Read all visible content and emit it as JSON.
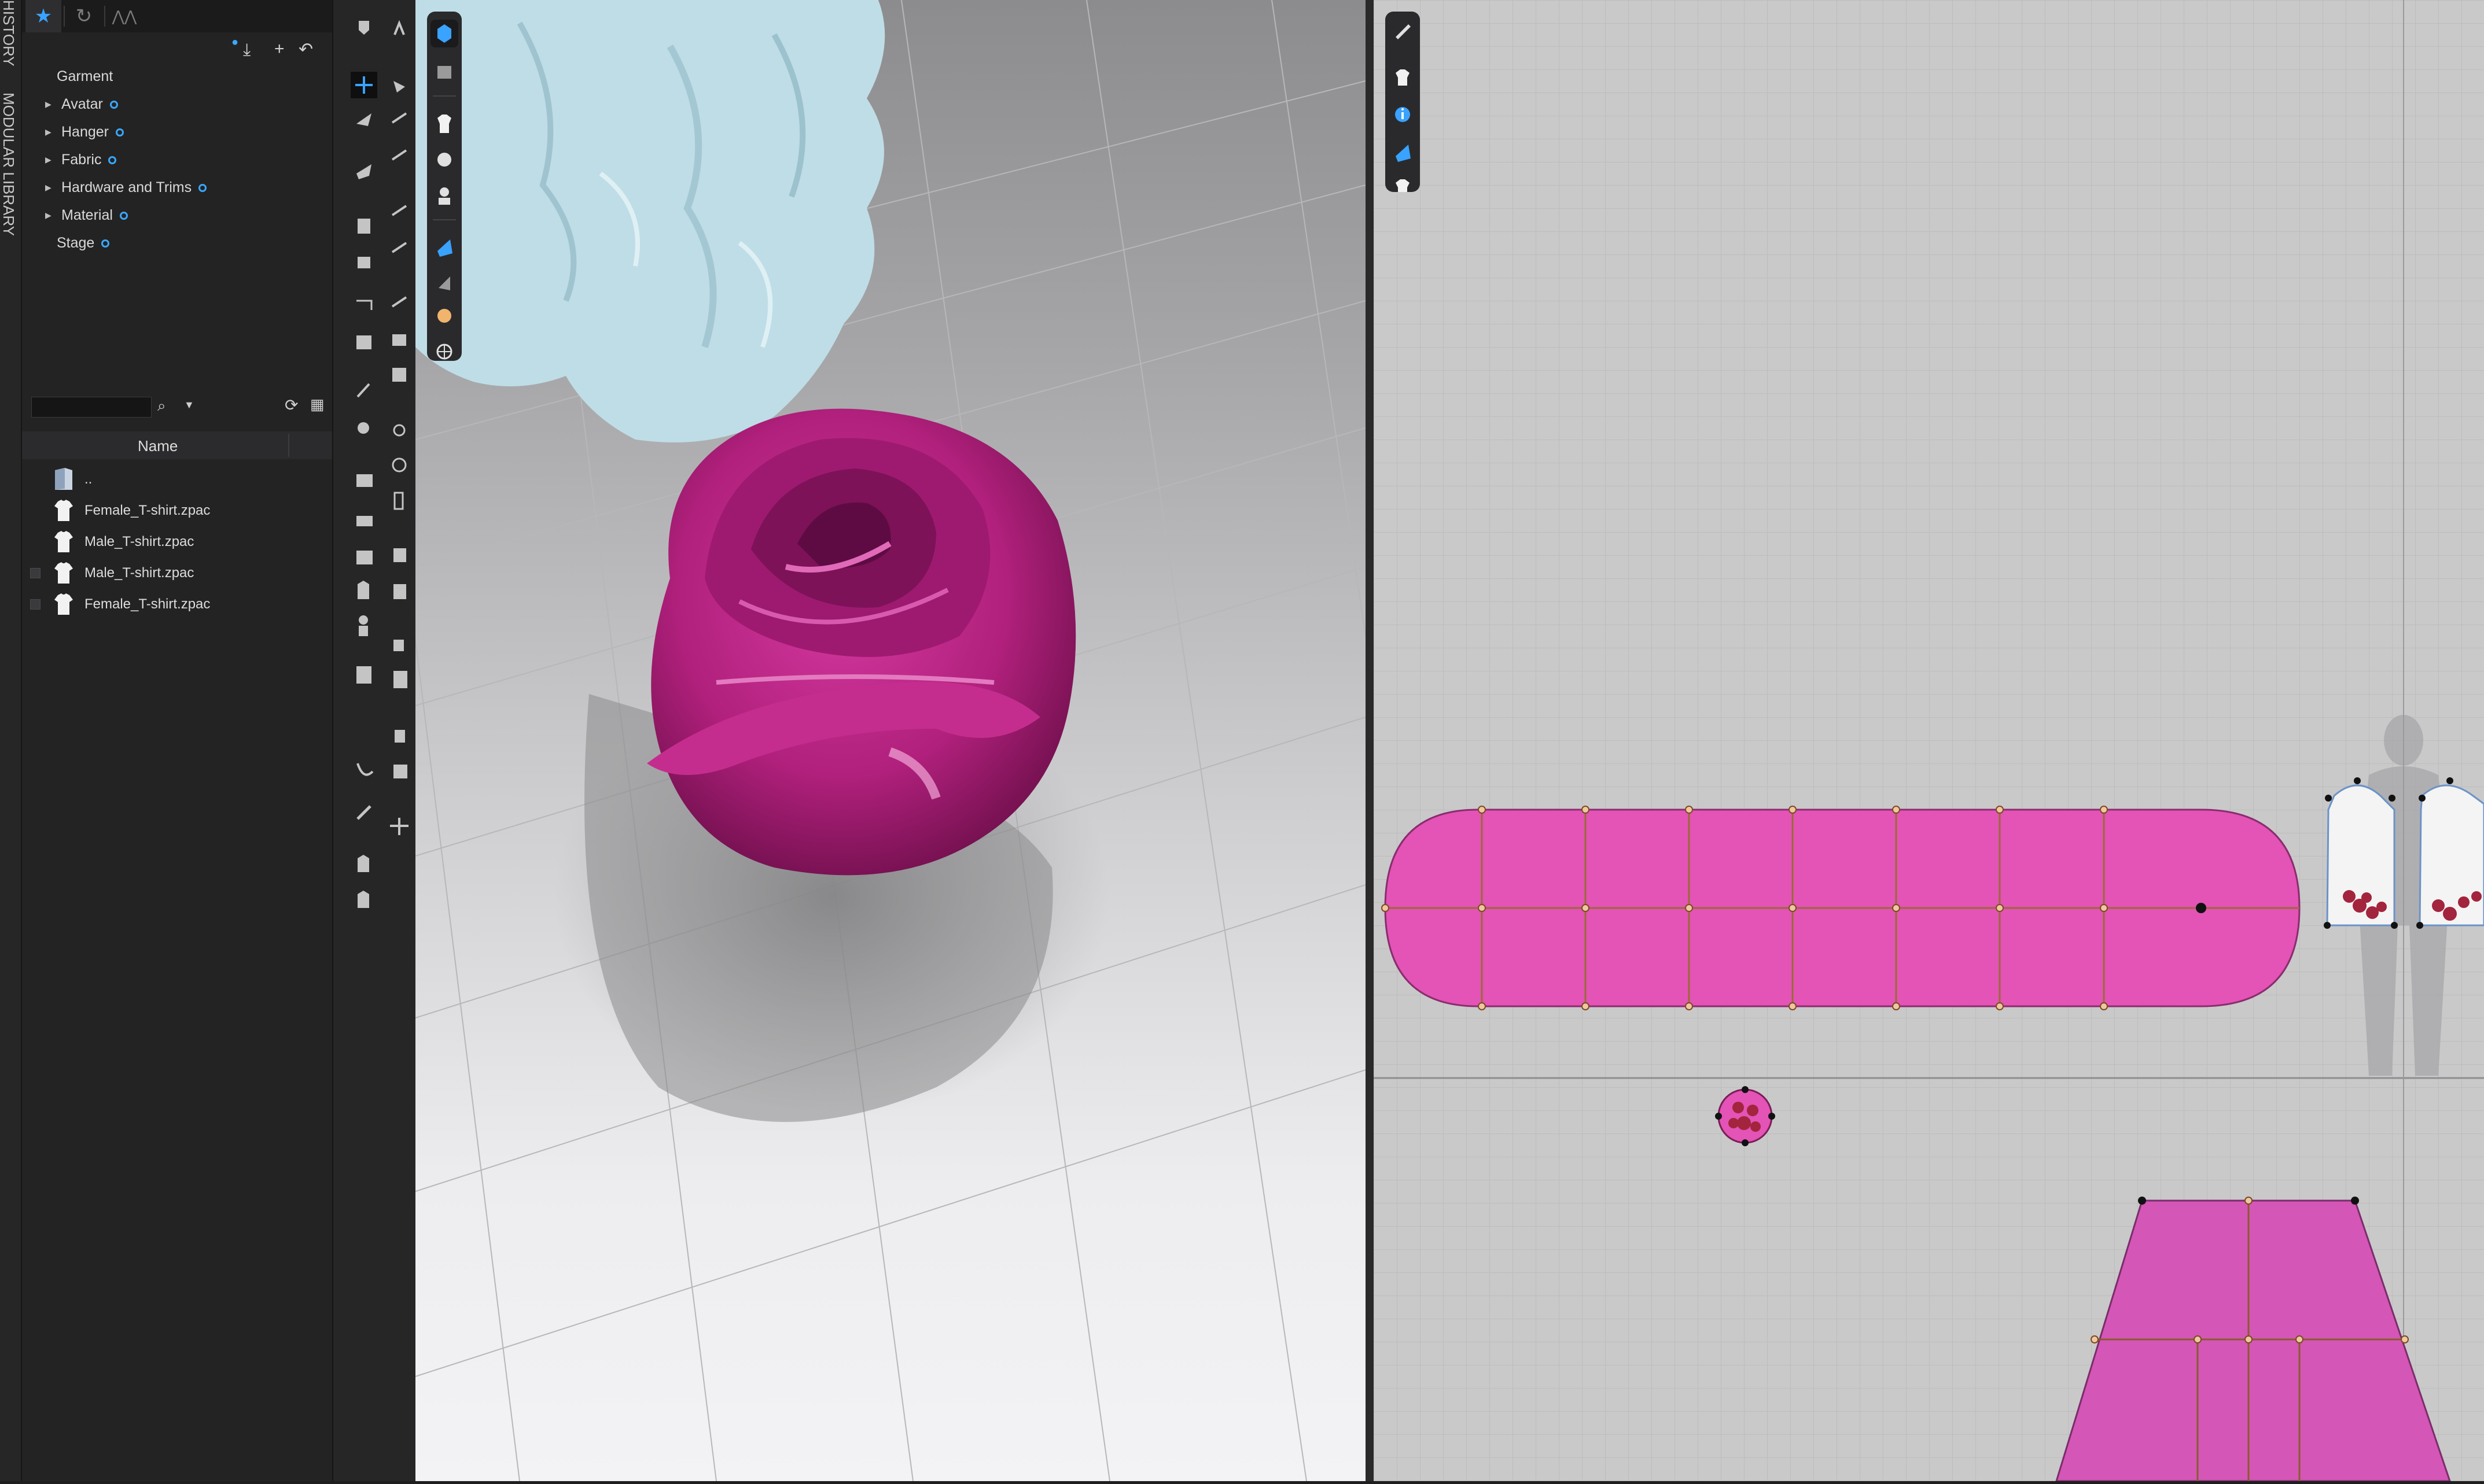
{
  "side_tabs": [
    "HISTORY",
    "MODULAR LIBRARY"
  ],
  "library": {
    "tabs": [
      {
        "icon": "star-icon",
        "active": true
      },
      {
        "icon": "history-icon",
        "active": false
      },
      {
        "icon": "clo-icon",
        "active": false
      }
    ],
    "tree": [
      {
        "label": "Garment",
        "expandable": false,
        "sync": false
      },
      {
        "label": "Avatar",
        "expandable": true,
        "sync": true
      },
      {
        "label": "Hanger",
        "expandable": true,
        "sync": true
      },
      {
        "label": "Fabric",
        "expandable": true,
        "sync": true
      },
      {
        "label": "Hardware and Trims",
        "expandable": true,
        "sync": true
      },
      {
        "label": "Material",
        "expandable": true,
        "sync": true
      },
      {
        "label": "Stage",
        "expandable": false,
        "sync": true
      }
    ],
    "search": {
      "placeholder": ""
    },
    "column_header": "Name",
    "files": [
      {
        "name": "..",
        "type": "folder",
        "checkbox": false
      },
      {
        "name": "Female_T-shirt.zpac",
        "type": "tshirt",
        "checkbox": false
      },
      {
        "name": "Male_T-shirt.zpac",
        "type": "tshirt",
        "checkbox": false
      },
      {
        "name": "Male_T-shirt.zpac",
        "type": "tshirt",
        "checkbox": true
      },
      {
        "name": "Female_T-shirt.zpac",
        "type": "tshirt",
        "checkbox": true
      }
    ]
  },
  "colors": {
    "accent": "#3aa2ff",
    "garment_pink": "#e453b6",
    "rose_dark": "#8e1662",
    "fabric_blue": "#bfdde6",
    "panel_bg": "#232324",
    "canvas_2d": "#c9c9ca"
  }
}
